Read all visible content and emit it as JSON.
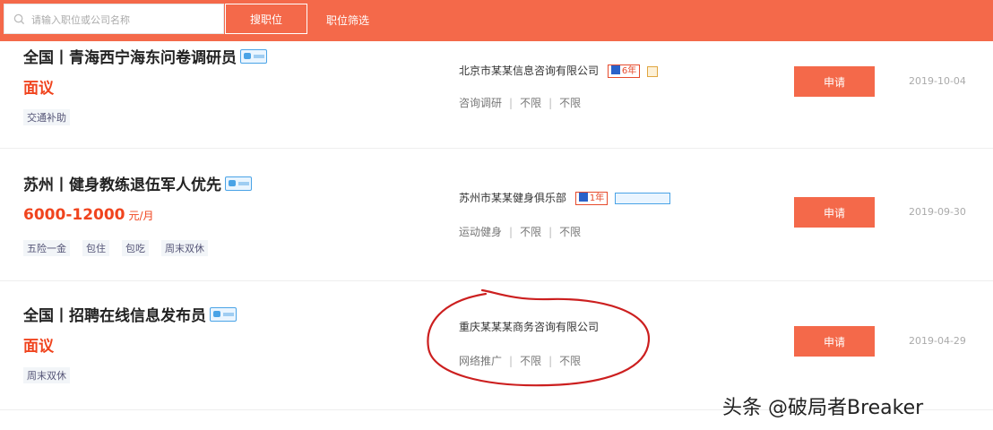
{
  "header": {
    "search_placeholder": "请输入职位或公司名称",
    "search_button": "搜职位",
    "link": "职位筛选"
  },
  "jobs": [
    {
      "title": "全国丨青海西宁海东问卷调研员",
      "salary": "面议",
      "salary_unit": "",
      "tags": [
        "交通补助"
      ],
      "company": "北京市某某信息咨询有限公司",
      "years": "6年",
      "meta": [
        "咨询调研",
        "不限",
        "不限"
      ],
      "apply": "申请",
      "date": "2019-10-04"
    },
    {
      "title": "苏州丨健身教练退伍军人优先",
      "salary": "6000-12000",
      "salary_unit": "元/月",
      "tags": [
        "五险一金",
        "包住",
        "包吃",
        "周末双休"
      ],
      "company": "苏州市某某健身俱乐部",
      "years": "1年",
      "meta": [
        "运动健身",
        "不限",
        "不限"
      ],
      "apply": "申请",
      "date": "2019-09-30"
    },
    {
      "title": "全国丨招聘在线信息发布员",
      "salary": "面议",
      "salary_unit": "",
      "tags": [
        "周末双休"
      ],
      "company": "重庆某某某商务咨询有限公司",
      "years": "",
      "meta": [
        "网络推广",
        "不限",
        "不限"
      ],
      "apply": "申请",
      "date": "2019-04-29"
    }
  ],
  "watermark": "头条 @破局者Breaker",
  "colors": {
    "accent": "#f4694a",
    "salary": "#f0441e",
    "circle": "#cc1f1f"
  }
}
